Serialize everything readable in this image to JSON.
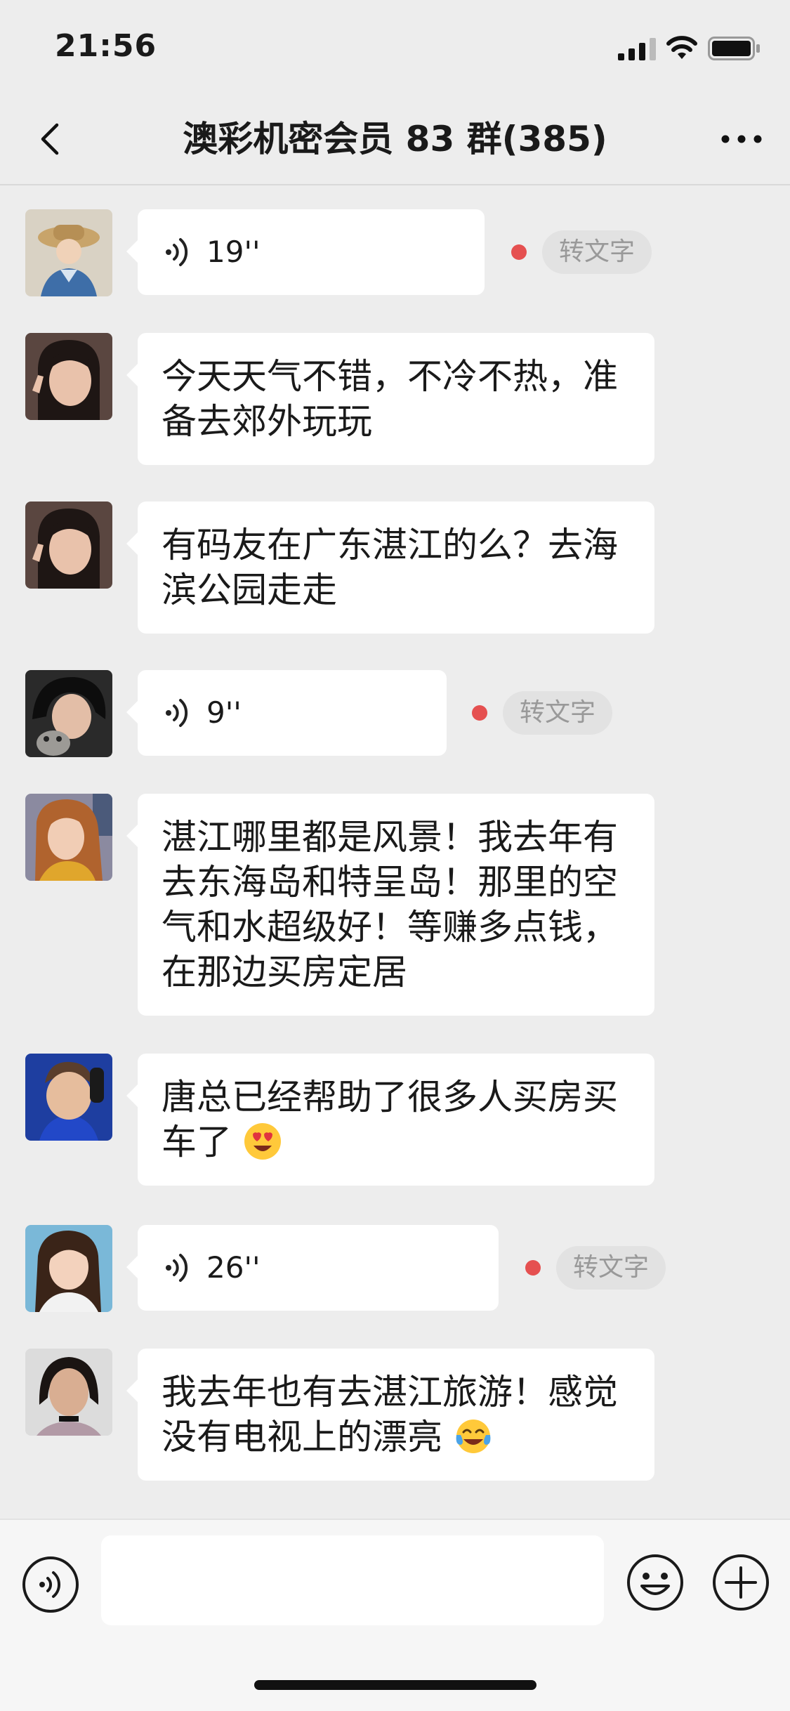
{
  "status_bar": {
    "time": "21:56"
  },
  "header": {
    "title": "澳彩机密会员 83 群(385)"
  },
  "messages": [
    {
      "type": "voice",
      "duration": "19''",
      "convert_label": "转文字"
    },
    {
      "type": "text",
      "text": "今天天气不错，不冷不热，准备去郊外玩玩"
    },
    {
      "type": "text",
      "text": "有码友在广东湛江的么？去海滨公园走走"
    },
    {
      "type": "voice",
      "duration": "9''",
      "convert_label": "转文字"
    },
    {
      "type": "text",
      "text": "湛江哪里都是风景！我去年有去东海岛和特呈岛！那里的空气和水超级好！等赚多点钱，在那边买房定居"
    },
    {
      "type": "text",
      "text": "唐总已经帮助了很多人买房买车了",
      "emoji": "heart-eyes-emoji"
    },
    {
      "type": "voice",
      "duration": "26''",
      "convert_label": "转文字"
    },
    {
      "type": "text",
      "text": "我去年也有去湛江旅游！感觉没有电视上的漂亮",
      "emoji": "tears-of-joy-emoji"
    }
  ],
  "input_bar": {
    "placeholder": ""
  },
  "colors": {
    "background": "#ededed",
    "bubble": "#ffffff",
    "unread_dot": "#e55050",
    "convert_bg": "#e2e2e2"
  }
}
